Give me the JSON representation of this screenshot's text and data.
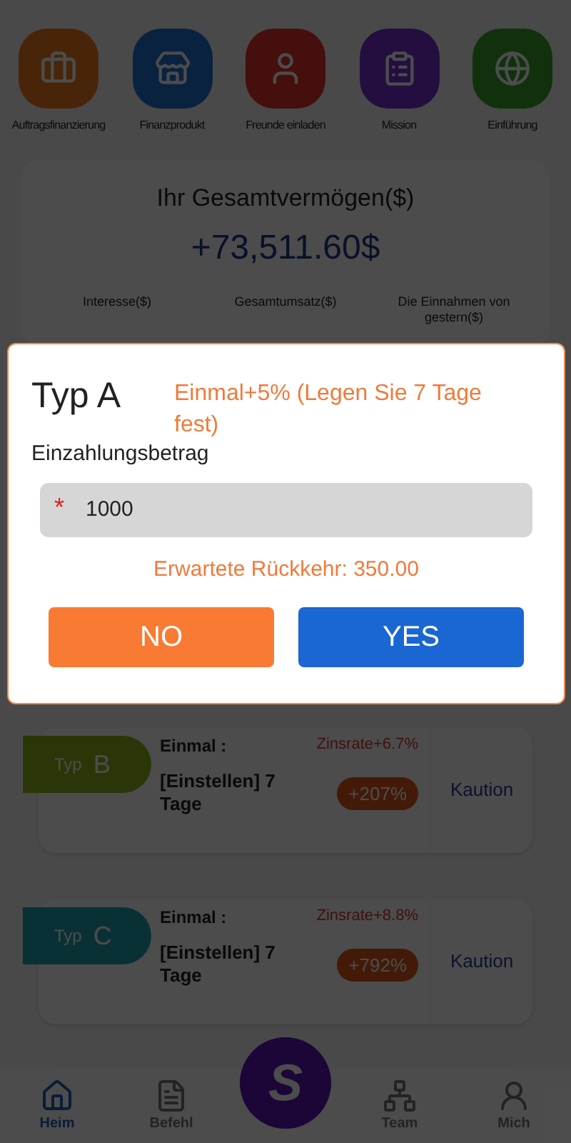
{
  "shortcuts": [
    {
      "label": "Auftragsfinanzierung",
      "kind": "briefcase"
    },
    {
      "label": "Finanzprodukt",
      "kind": "store"
    },
    {
      "label": "Freunde einladen",
      "kind": "person"
    },
    {
      "label": "Mission",
      "kind": "clipboard"
    },
    {
      "label": "Einführung",
      "kind": "globe"
    }
  ],
  "summary": {
    "title": "Ihr Gesamtvermögen($)",
    "value": "+73,511.60$",
    "stats": [
      "Interesse($)",
      "Gesamtumsatz($)",
      "Die Einnahmen von gestern($)"
    ]
  },
  "plans": [
    {
      "tag_prefix": "Typ",
      "tag_letter": "B",
      "once_label": "Einmal :",
      "rate": "Zinsrate+6.7%",
      "term": "[Einstellen] 7 Tage",
      "gain": "+207%",
      "action": "Kaution"
    },
    {
      "tag_prefix": "Typ",
      "tag_letter": "C",
      "once_label": "Einmal :",
      "rate": "Zinsrate+8.8%",
      "term": "[Einstellen] 7 Tage",
      "gain": "+792%",
      "action": "Kaution"
    }
  ],
  "nav": {
    "items": [
      {
        "label": "Heim",
        "kind": "home",
        "selected": true
      },
      {
        "label": "Befehl",
        "kind": "order",
        "selected": false
      },
      {
        "label": "Team",
        "kind": "team",
        "selected": false
      },
      {
        "label": "Mich",
        "kind": "me",
        "selected": false
      }
    ],
    "center_label": "S"
  },
  "dialog": {
    "title": "Typ A",
    "note": "Einmal+5% (Legen Sie 7 Tage fest)",
    "field_label": "Einzahlungsbetrag",
    "field": {
      "required_mark": "*",
      "value": "1000"
    },
    "expected": "Erwartete Rückkehr: 350.00",
    "buttons": [
      {
        "label": "NO",
        "kind": "cancel"
      },
      {
        "label": "YES",
        "kind": "confirm"
      }
    ]
  }
}
